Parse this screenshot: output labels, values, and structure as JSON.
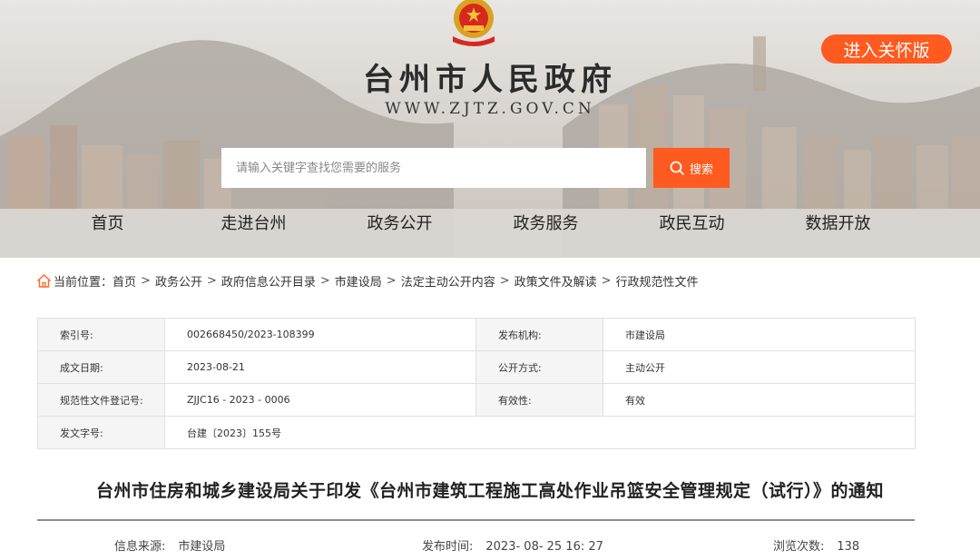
{
  "header": {
    "site_title": "台州市人民政府",
    "site_url": "WWW.ZJTZ.GOV.CN",
    "care_mode_label": "进入关怀版",
    "search_placeholder": "请输入关键字查找您需要的服务",
    "search_label": "搜索",
    "accent_color": "#ff5a1f"
  },
  "nav": [
    "首页",
    "走进台州",
    "政务公开",
    "政务服务",
    "政民互动",
    "数据开放"
  ],
  "breadcrumb": {
    "prefix": "当前位置：",
    "items": [
      "首页",
      "政务公开",
      "政府信息公开目录",
      "市建设局",
      "法定主动公开内容",
      "政策文件及解读",
      "行政规范性文件"
    ],
    "separator": ">"
  },
  "meta": {
    "index_label": "索引号:",
    "index_value": "002668450/2023-108399",
    "publisher_label": "发布机构:",
    "publisher_value": "市建设局",
    "date_label": "成文日期:",
    "date_value": "2023-08-21",
    "disclosure_label": "公开方式:",
    "disclosure_value": "主动公开",
    "reg_label": "规范性文件登记号:",
    "reg_value": "ZJJC16 - 2023 - 0006",
    "validity_label": "有效性:",
    "validity_value": "有效",
    "docno_label": "发文字号:",
    "docno_value": "台建〔2023〕155号"
  },
  "article": {
    "title": "台州市住房和城乡建设局关于印发《台州市建筑工程施工高处作业吊篮安全管理规定（试行）》的通知",
    "source_label": "信息来源:",
    "source_value": "市建设局",
    "time_label": "发布时间:",
    "time_value": "2023- 08- 25 16: 27",
    "views_label": "浏览次数:",
    "views_value": "138"
  }
}
